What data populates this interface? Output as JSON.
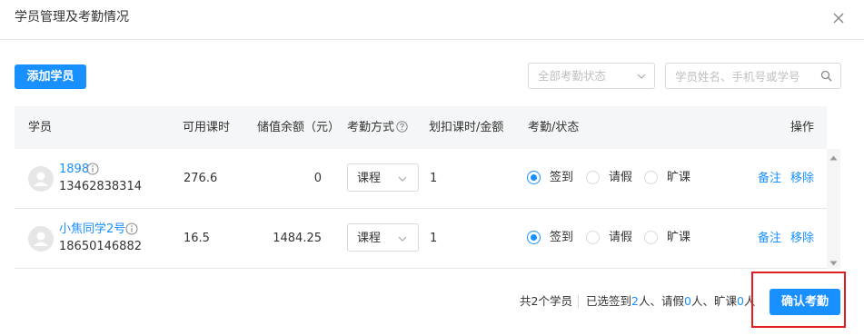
{
  "dialog": {
    "title": "学员管理及考勤情况",
    "close_icon": "close-icon"
  },
  "toolbar": {
    "add_button": "添加学员",
    "status_select_placeholder": "全部考勤状态",
    "search_placeholder": "学员姓名、手机号或学号"
  },
  "table": {
    "headers": {
      "student": "学员",
      "available_hours": "可用课时",
      "balance": "储值余额（元）",
      "mode": "考勤方式",
      "deduct": "划扣课时/金额",
      "status": "考勤/状态",
      "actions": "操作"
    },
    "rows": [
      {
        "name": "1898",
        "phone": "13462838314",
        "available_hours": "276.6",
        "balance": "0",
        "mode": "课程",
        "deduct": "1",
        "sign_in": "签到",
        "leave": "请假",
        "absent": "旷课",
        "selected": "签到",
        "note": "备注",
        "remove": "移除"
      },
      {
        "name": "小焦同学2号",
        "phone": "18650146882",
        "available_hours": "16.5",
        "balance": "1484.25",
        "mode": "课程",
        "deduct": "1",
        "sign_in": "签到",
        "leave": "请假",
        "absent": "旷课",
        "selected": "签到",
        "note": "备注",
        "remove": "移除"
      }
    ]
  },
  "footer": {
    "total_text": "共2个学员",
    "selected_prefix": "已选签到",
    "signed_count": "2",
    "signed_unit": "人、请假",
    "leave_count": "0",
    "leave_unit": "人、旷课",
    "absent_count": "0",
    "absent_unit": "人",
    "confirm_button": "确认考勤"
  },
  "colors": {
    "primary": "#1890ff",
    "highlight": "#e02020"
  }
}
